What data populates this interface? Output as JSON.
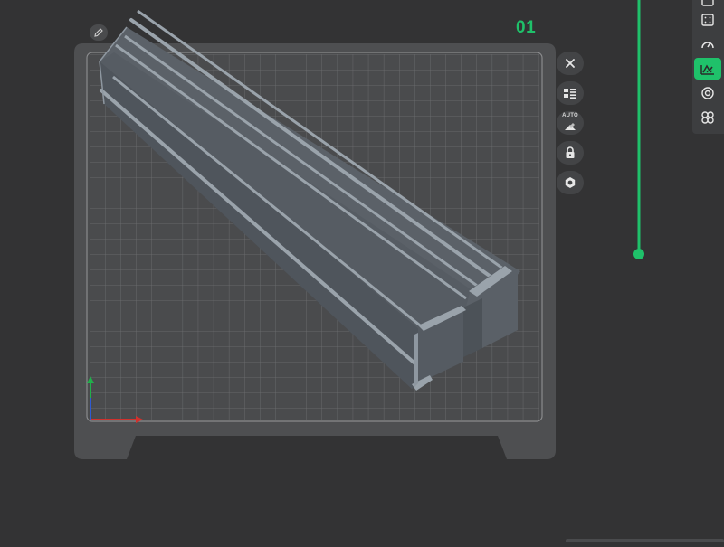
{
  "plate": {
    "label": "01"
  },
  "plate_tools": [
    {
      "name": "close-plate-button",
      "icon": "close-icon"
    },
    {
      "name": "arrange-objects-button",
      "icon": "list-icon"
    },
    {
      "name": "auto-orient-button",
      "icon": "auto-orient-icon",
      "label": "AUTO"
    },
    {
      "name": "lock-plate-button",
      "icon": "lock-icon"
    },
    {
      "name": "plate-settings-button",
      "icon": "gear-icon"
    }
  ],
  "side_toolbar": [
    {
      "name": "view-top-button",
      "icon": "panel-icon",
      "active": false
    },
    {
      "name": "layers-view-button",
      "icon": "grid-panel-icon",
      "active": false
    },
    {
      "name": "speed-view-button",
      "icon": "gauge-icon",
      "active": false
    },
    {
      "name": "preview-mode-button",
      "icon": "slice-preview-icon",
      "active": true
    },
    {
      "name": "view-target-button",
      "icon": "target-icon",
      "active": false
    },
    {
      "name": "view-all-button",
      "icon": "cluster-icon",
      "active": false
    }
  ],
  "colors": {
    "background": "#333334",
    "plate_body": "#4e4f51",
    "plate_grid": "#6d6e70",
    "plate_surface": "#4a4b4d",
    "model": "#5e646b",
    "model_edge": "#9aa3ab",
    "accent": "#1fc16a",
    "axis_x": "#d0312d",
    "axis_y": "#2f5bd3",
    "axis_z": "#21b04b"
  }
}
